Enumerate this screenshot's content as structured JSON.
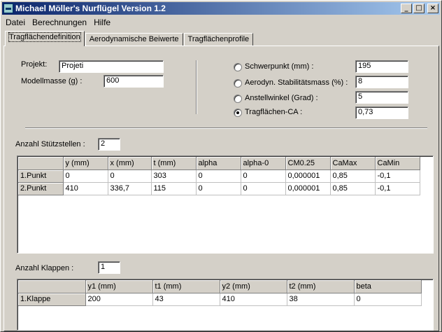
{
  "window": {
    "title": "Michael Möller's Nurflügel Version 1.2"
  },
  "menu": [
    "Datei",
    "Berechnungen",
    "Hilfe"
  ],
  "tabs": [
    "Tragflächendefinition",
    "Aerodynamische Beiwerte",
    "Tragflächenprofile"
  ],
  "form": {
    "projekt_label": "Projekt:",
    "projekt_value": "Projeti",
    "modellmasse_label": "Modellmasse (g) :",
    "modellmasse_value": "600",
    "options": [
      {
        "label": "Schwerpunkt (mm) :",
        "value": "195",
        "checked": false
      },
      {
        "label": "Aerodyn. Stabilitätsmass (%) :",
        "value": "8",
        "checked": false
      },
      {
        "label": "Anstellwinkel (Grad) :",
        "value": "5",
        "checked": false
      },
      {
        "label": "Tragflächen-CA :",
        "value": "0,73",
        "checked": true
      }
    ]
  },
  "stuetzstellen": {
    "label": "Anzahl Stützstellen :",
    "count": "2",
    "columns": [
      "y (mm)",
      "x (mm)",
      "t (mm)",
      "alpha",
      "alpha-0",
      "CM0.25",
      "CaMax",
      "CaMin"
    ],
    "rows": [
      {
        "head": "1.Punkt",
        "cells": [
          "0",
          "0",
          "303",
          "0",
          "0",
          "0,000001",
          "0,85",
          "-0,1"
        ]
      },
      {
        "head": "2.Punkt",
        "cells": [
          "410",
          "336,7",
          "115",
          "0",
          "0",
          "0,000001",
          "0,85",
          "-0,1"
        ]
      }
    ]
  },
  "klappen": {
    "label": "Anzahl Klappen :",
    "count": "1",
    "columns": [
      "y1 (mm)",
      "t1 (mm)",
      "y2 (mm)",
      "t2 (mm)",
      "beta"
    ],
    "rows": [
      {
        "head": "1.Klappe",
        "cells": [
          "200",
          "43",
          "410",
          "38",
          "0"
        ]
      }
    ]
  }
}
